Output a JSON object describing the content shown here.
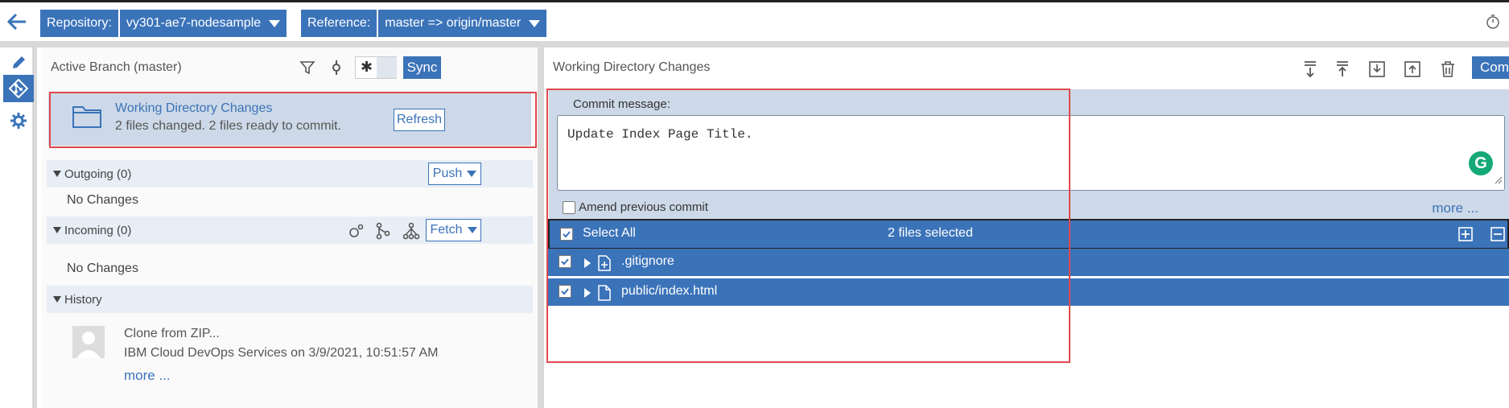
{
  "topbar": {
    "repository_label": "Repository:",
    "repository_value": "vy301-ae7-nodesample",
    "reference_label": "Reference:",
    "reference_value": "master => origin/master"
  },
  "left": {
    "header_title": "Active Branch (master)",
    "sync_label": "Sync",
    "wdc_title": "Working Directory Changes",
    "wdc_subtitle": "2 files changed. 2 files ready to commit.",
    "refresh_label": "Refresh",
    "outgoing_label": "Outgoing (0)",
    "push_label": "Push",
    "outgoing_empty": "No Changes",
    "incoming_label": "Incoming (0)",
    "fetch_label": "Fetch",
    "incoming_empty": "No Changes",
    "history_label": "History",
    "history_item_title": "Clone from ZIP...",
    "history_item_author": "IBM Cloud DevOps Services on 3/9/2021, 10:51:57 AM",
    "history_more": "more ..."
  },
  "right": {
    "header_title": "Working Directory Changes",
    "commit_button_label": "Comm",
    "commit_message_label": "Commit message:",
    "commit_message_value": "Update Index Page Title.",
    "amend_label": "Amend previous commit",
    "more_label": "more ...",
    "select_all_label": "Select All",
    "files_selected_label": "2 files selected",
    "files": [
      {
        "name": ".gitignore",
        "icon": "file-add-icon"
      },
      {
        "name": "public/index.html",
        "icon": "file-icon"
      }
    ]
  },
  "colors": {
    "accent": "#3b73b9",
    "highlight": "#e0484e",
    "panel": "#cdd9e8",
    "grammarly": "#15a878"
  }
}
